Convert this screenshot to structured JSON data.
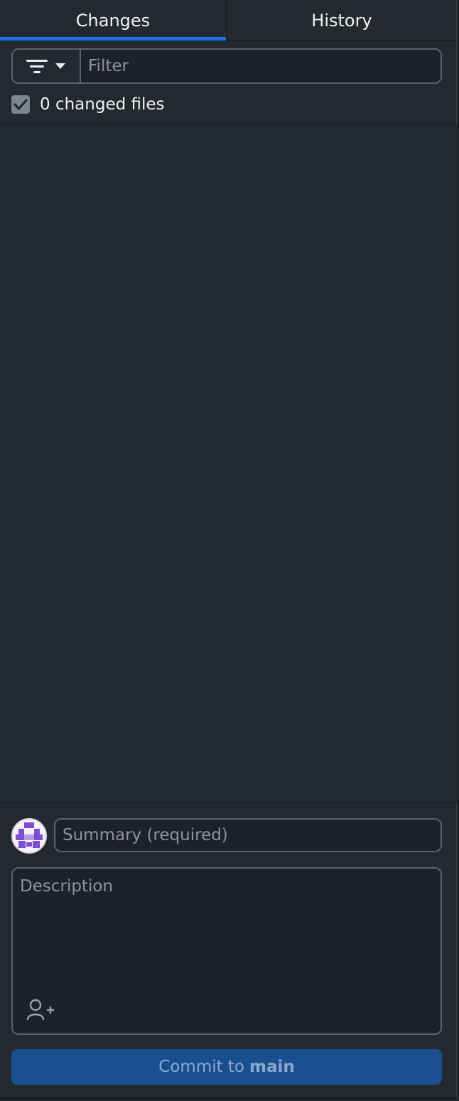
{
  "tabs": [
    {
      "label": "Changes",
      "active": true
    },
    {
      "label": "History",
      "active": false
    }
  ],
  "filter": {
    "button_icon": "filter-icon",
    "dropdown_icon": "caret-down-icon",
    "placeholder": "Filter",
    "value": ""
  },
  "changed_files": {
    "checked": true,
    "label": "0 changed files"
  },
  "commit": {
    "summary_placeholder": "Summary (required)",
    "description_placeholder": "Description",
    "coauthor_icon": "person-add-icon",
    "button_prefix": "Commit to",
    "branch": "main"
  },
  "colors": {
    "accent": "#1f6feb",
    "commit_button": "#1a4f8f",
    "avatar": "#7b4fd0"
  }
}
